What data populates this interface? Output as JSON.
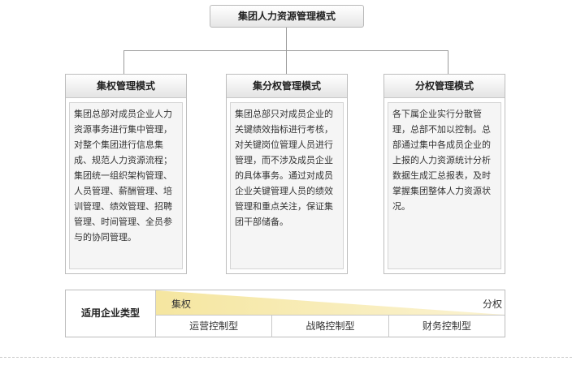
{
  "root": {
    "title": "集团人力资源管理模式"
  },
  "cards": [
    {
      "title": "集权管理模式",
      "body": "集团总部对成员企业人力资源事务进行集中管理，对整个集团进行信息集成、规范人力资源流程；\n集团统一组织架构管理、人员管理、薪酬管理、培训管理、绩效管理、招聘管理、时间管理、全员参与的协同管理。"
    },
    {
      "title": "集分权管理模式",
      "body": "集团总部只对成员企业的关键绩效指标进行考核，对关键岗位管理人员进行管理，而不涉及成员企业的具体事务。通过对成员企业关键管理人员的绩效管理和重点关注，保证集团干部储备。"
    },
    {
      "title": "分权管理模式",
      "body": "各下属企业实行分散管理，总部不加以控制。总部通过集中各成员企业的上报的人力资源统计分析数据生成汇总报表，及时掌握集团整体人力资源状况。"
    }
  ],
  "scale": {
    "label": "适用企业类型",
    "left": "集权",
    "right": "分权",
    "types": [
      "运营控制型",
      "战略控制型",
      "财务控制型"
    ],
    "colors": {
      "gradient": "#f7e8a6"
    }
  }
}
